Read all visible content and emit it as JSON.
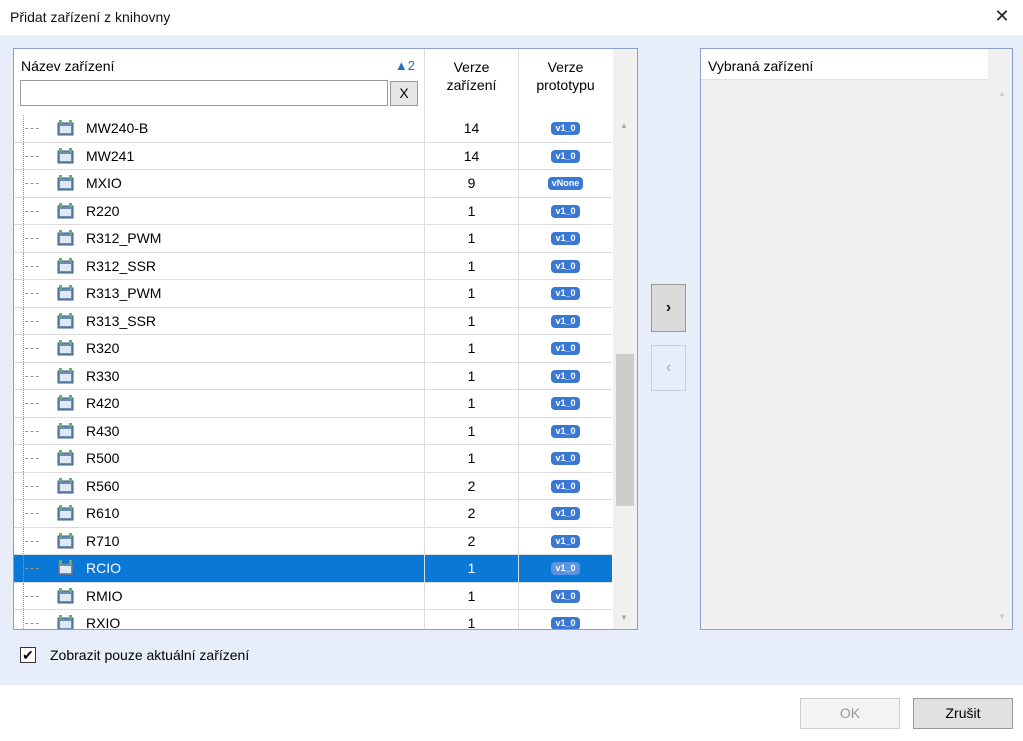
{
  "window": {
    "title": "Přidat zařízení z knihovny",
    "close_glyph": "✕"
  },
  "grid": {
    "header": {
      "name_label": "Název zařízení",
      "sort_indicator": "▲2",
      "filter_value": "",
      "clear_button": "X",
      "version_line1": "Verze",
      "version_line2": "zařízení",
      "proto_line1": "Verze",
      "proto_line2": "prototypu"
    },
    "rows": [
      {
        "name": "MW240-B",
        "version": "14",
        "proto": "v1_0"
      },
      {
        "name": "MW241",
        "version": "14",
        "proto": "v1_0"
      },
      {
        "name": "MXIO",
        "version": "9",
        "proto": "vNone"
      },
      {
        "name": "R220",
        "version": "1",
        "proto": "v1_0"
      },
      {
        "name": "R312_PWM",
        "version": "1",
        "proto": "v1_0"
      },
      {
        "name": "R312_SSR",
        "version": "1",
        "proto": "v1_0"
      },
      {
        "name": "R313_PWM",
        "version": "1",
        "proto": "v1_0"
      },
      {
        "name": "R313_SSR",
        "version": "1",
        "proto": "v1_0"
      },
      {
        "name": "R320",
        "version": "1",
        "proto": "v1_0"
      },
      {
        "name": "R330",
        "version": "1",
        "proto": "v1_0"
      },
      {
        "name": "R420",
        "version": "1",
        "proto": "v1_0"
      },
      {
        "name": "R430",
        "version": "1",
        "proto": "v1_0"
      },
      {
        "name": "R500",
        "version": "1",
        "proto": "v1_0"
      },
      {
        "name": "R560",
        "version": "2",
        "proto": "v1_0"
      },
      {
        "name": "R610",
        "version": "2",
        "proto": "v1_0"
      },
      {
        "name": "R710",
        "version": "2",
        "proto": "v1_0"
      },
      {
        "name": "RCIO",
        "version": "1",
        "proto": "v1_0",
        "selected": true
      },
      {
        "name": "RMIO",
        "version": "1",
        "proto": "v1_0"
      },
      {
        "name": "RXIO",
        "version": "1",
        "proto": "v1_0"
      }
    ]
  },
  "transfer": {
    "add_glyph": "›",
    "remove_glyph": "‹"
  },
  "selected_panel": {
    "header": "Vybraná zařízení"
  },
  "options": {
    "show_current_label": "Zobrazit pouze aktuální zařízení",
    "show_current_checked": "✔"
  },
  "footer": {
    "ok_label": "OK",
    "cancel_label": "Zrušit"
  },
  "colors": {
    "selection": "#0a78d7",
    "badge": "#3a78d4",
    "background": "#e8eef9"
  }
}
